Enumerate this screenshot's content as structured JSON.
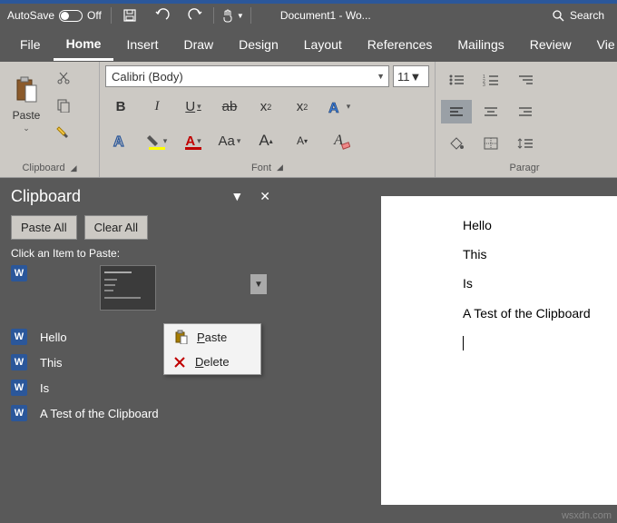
{
  "titlebar": {
    "autosave_label": "AutoSave",
    "autosave_state": "Off",
    "doc_title": "Document1 - Wo...",
    "search_label": "Search"
  },
  "tabs": {
    "file": "File",
    "home": "Home",
    "insert": "Insert",
    "draw": "Draw",
    "design": "Design",
    "layout": "Layout",
    "references": "References",
    "mailings": "Mailings",
    "review": "Review",
    "view": "Vie"
  },
  "ribbon": {
    "clipboard": {
      "paste": "Paste",
      "label": "Clipboard"
    },
    "font": {
      "name": "Calibri (Body)",
      "size": "11",
      "label": "Font",
      "bold": "B",
      "italic": "I",
      "underline": "U",
      "strike": "ab",
      "sub": "x",
      "sup": "x",
      "aa": "Aa",
      "a_big": "A",
      "a_small": "A"
    },
    "paragraph": {
      "label": "Paragr"
    }
  },
  "pane": {
    "title": "Clipboard",
    "paste_all": "Paste All",
    "clear_all": "Clear All",
    "hint": "Click an Item to Paste:",
    "items": [
      "Hello",
      "This",
      "Is",
      "A Test of the Clipboard"
    ]
  },
  "context_menu": {
    "paste": "Paste",
    "delete": "Delete"
  },
  "document": {
    "lines": [
      "Hello",
      "This",
      "Is",
      "A Test of the Clipboard"
    ]
  },
  "watermark": "wsxdn.com"
}
